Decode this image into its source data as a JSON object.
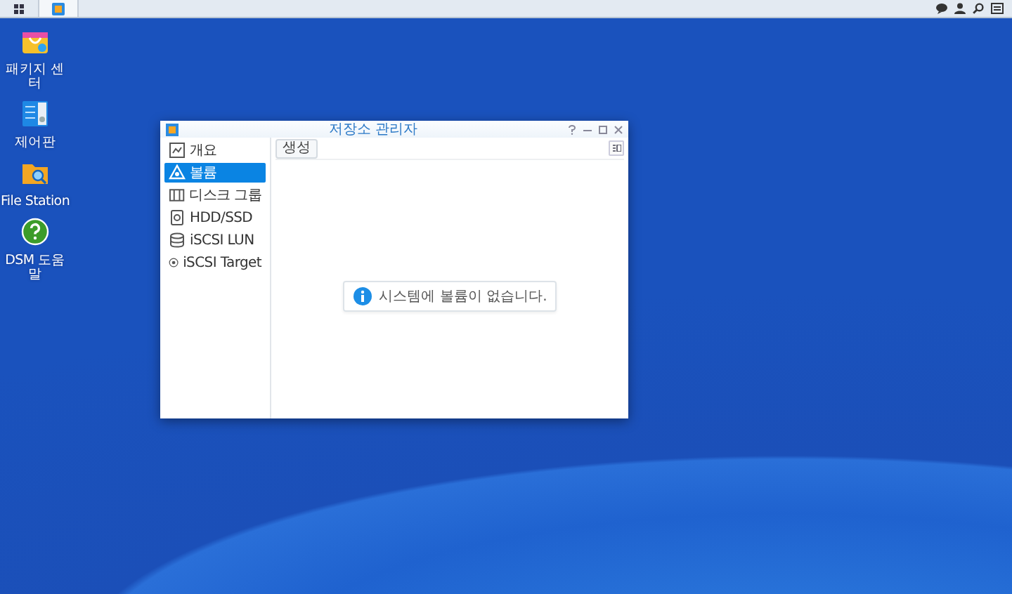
{
  "desktop_icons": [
    {
      "label": "패키지 센터",
      "kind": "package"
    },
    {
      "label": "제어판",
      "kind": "control"
    },
    {
      "label": "File Station",
      "kind": "folder"
    },
    {
      "label": "DSM 도움말",
      "kind": "help"
    }
  ],
  "window": {
    "title": "저장소 관리자",
    "sidebar": {
      "items": [
        {
          "label": "개요",
          "kind": "overview",
          "selected": false
        },
        {
          "label": "볼륨",
          "kind": "volume",
          "selected": true
        },
        {
          "label": "디스크 그룹",
          "kind": "diskgroup",
          "selected": false
        },
        {
          "label": "HDD/SSD",
          "kind": "hdd",
          "selected": false
        },
        {
          "label": "iSCSI LUN",
          "kind": "lun",
          "selected": false
        },
        {
          "label": "iSCSI Target",
          "kind": "target",
          "selected": false
        }
      ]
    },
    "toolbar": {
      "create_button": "생성"
    },
    "message": "시스템에 볼륨이 없습니다."
  }
}
